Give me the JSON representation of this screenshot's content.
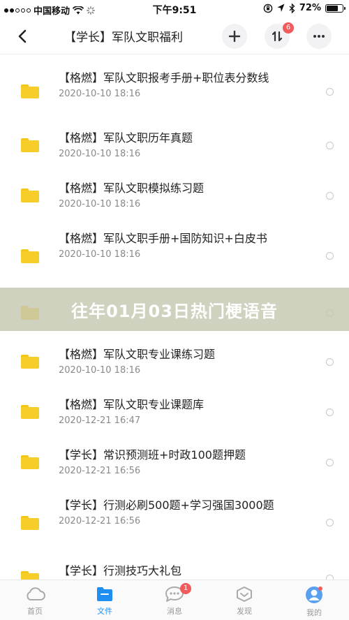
{
  "status_bar": {
    "carrier": "中国移动",
    "time": "下午9:51",
    "battery_text": "72%",
    "battery_level": 0.72,
    "signal_dots_filled": 2
  },
  "header": {
    "back_icon": "chevron-left-icon",
    "title": "【学长】军队文职福利",
    "add_icon": "plus-icon",
    "sort_icon": "sort-icon",
    "sort_badge": "6",
    "more_icon": "more-icon"
  },
  "colors": {
    "accent": "#1f8ef1",
    "folder": "#f7cd2a",
    "badge": "#f25b5b",
    "overlay": "#c4c8b0"
  },
  "files": [
    {
      "name": "【格燃】军队文职报考手册+职位表分数线",
      "date": "2020-10-10 18:16"
    },
    {
      "name": "【格燃】军队文职历年真题",
      "date": "2020-10-10 18:16"
    },
    {
      "name": "【格燃】军队文职模拟练习题",
      "date": "2020-10-10 18:16"
    },
    {
      "name": "【格燃】军队文职手册+国防知识+白皮书",
      "date": "2020-10-10 18:16"
    },
    {
      "name": "",
      "date": ""
    },
    {
      "name": "【格燃】军队文职专业课练习题",
      "date": "2020-10-10 18:16"
    },
    {
      "name": "【格燃】军队文职专业课题库",
      "date": "2020-12-21 16:47"
    },
    {
      "name": "【学长】常识预测班+时政100题押题",
      "date": "2020-12-21 16:56"
    },
    {
      "name": "【学长】行测必刷500题+学习强国3000题",
      "date": "2020-12-21 16:56"
    },
    {
      "name": "【学长】行测技巧大礼包",
      "date": ""
    }
  ],
  "overlay": {
    "text": "往年01月03日热门梗语音"
  },
  "tab_bar": {
    "tabs": [
      {
        "label": "首页",
        "icon": "cloud-home-icon",
        "active": false
      },
      {
        "label": "文件",
        "icon": "folder-icon",
        "active": true
      },
      {
        "label": "消息",
        "icon": "chat-icon",
        "active": false,
        "badge": "1"
      },
      {
        "label": "发现",
        "icon": "discover-icon",
        "active": false
      },
      {
        "label": "我的",
        "icon": "avatar-icon",
        "active": false
      }
    ]
  }
}
